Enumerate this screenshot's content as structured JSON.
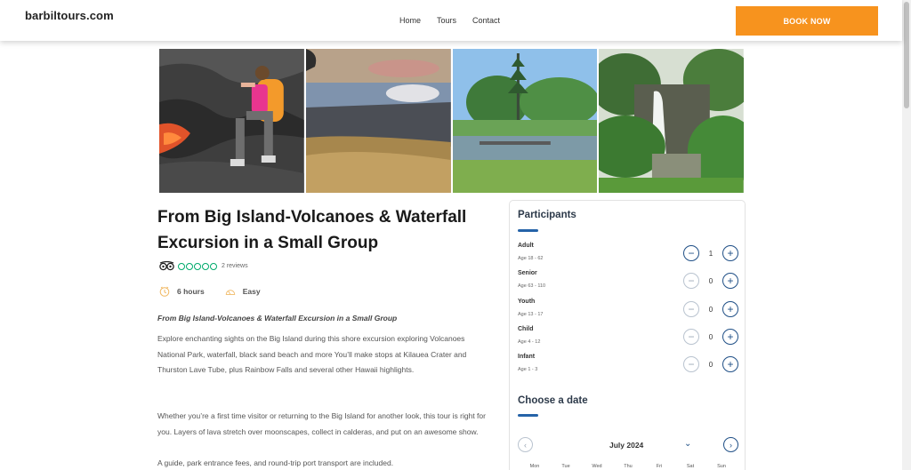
{
  "header": {
    "logo": "barbiltours.com",
    "nav": [
      "Home",
      "Tours",
      "Contact"
    ],
    "book_button": "BOOK NOW",
    "accent_color": "#f7931e"
  },
  "gallery": {
    "photos": [
      "lava-hiker-photo",
      "volcano-crater-photo",
      "park-pond-photo",
      "rainbow-falls-photo"
    ]
  },
  "tour": {
    "title": "From Big Island-Volcanoes & Waterfall Excursion in a Small Group",
    "rating_bubbles": 0,
    "reviews": "2 reviews",
    "duration": "6 hours",
    "difficulty": "Easy",
    "description_title": "From Big Island-Volcanoes & Waterfall Excursion in a Small Group",
    "description_p1": "Explore enchanting sights on the Big Island during this shore excursion exploring Volcanoes National Park, waterfall, black sand beach and more You’ll make stops at Kilauea Crater and Thurston Lave Tube, plus Rainbow Falls and several other Hawaii highlights.",
    "description_p2": "Whether you’re a first time visitor or returning to the Big Island for another look, this tour is right for you. Layers of lava stretch over moonscapes, collect in calderas, and put on an awesome show.",
    "description_p3": "A guide, park entrance fees, and round-trip port transport are included."
  },
  "booking": {
    "participants_heading": "Participants",
    "participants": [
      {
        "label": "Adult",
        "age": "Age 18 - 62",
        "value": "1"
      },
      {
        "label": "Senior",
        "age": "Age 63 - 110",
        "value": "0"
      },
      {
        "label": "Youth",
        "age": "Age 13 - 17",
        "value": "0"
      },
      {
        "label": "Child",
        "age": "Age 4 - 12",
        "value": "0"
      },
      {
        "label": "Infant",
        "age": "Age 1 - 3",
        "value": "0"
      }
    ],
    "date_heading": "Choose a date",
    "month": "July 2024",
    "weekdays": [
      "Mon",
      "Tue",
      "Wed",
      "Thu",
      "Fri",
      "Sat",
      "Sun"
    ],
    "brand_color": "#1f4f86"
  }
}
